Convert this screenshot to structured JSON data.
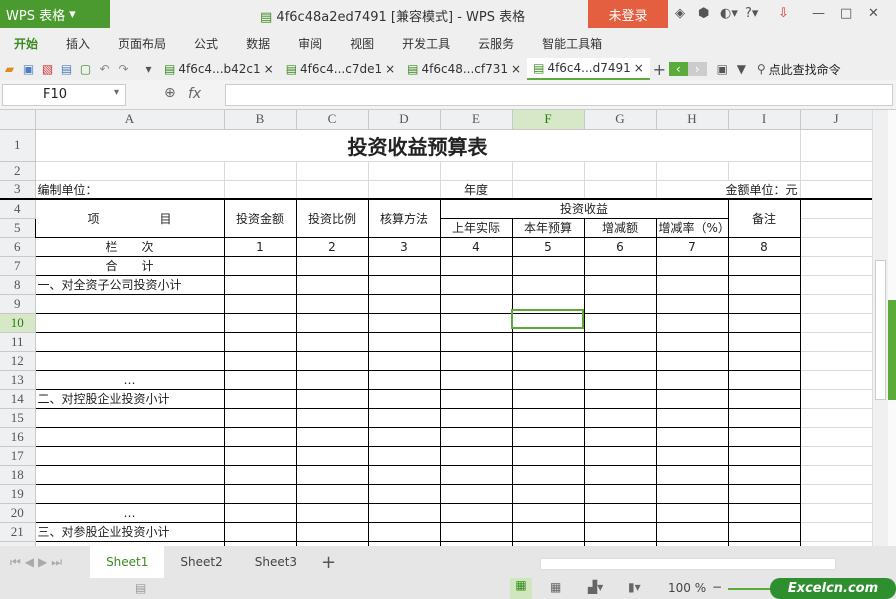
{
  "app": {
    "logo": "WPS 表格",
    "title": "4f6c48a2ed7491 [兼容模式] - WPS 表格",
    "login": "未登录"
  },
  "menu": [
    "开始",
    "插入",
    "页面布局",
    "公式",
    "数据",
    "审阅",
    "视图",
    "开发工具",
    "云服务",
    "智能工具箱"
  ],
  "doc_tabs": [
    {
      "label": "4f6c4...b42c1",
      "active": false
    },
    {
      "label": "4f6c4...c7de1",
      "active": false
    },
    {
      "label": "4f6c48...cf731",
      "active": false
    },
    {
      "label": "4f6c4...d7491",
      "active": true
    }
  ],
  "search_label": "点此查找命令",
  "formula": {
    "namebox": "F10",
    "fx": "fx",
    "value": ""
  },
  "columns": [
    "A",
    "B",
    "C",
    "D",
    "E",
    "F",
    "G",
    "H",
    "I",
    "J"
  ],
  "selected": {
    "col": "F",
    "row": "10"
  },
  "sheet": {
    "title": "投资收益预算表",
    "unit_label": "编制单位：",
    "year_label": "年度",
    "amount_unit": "金额单位：元",
    "header": {
      "item": "项　　　　　目",
      "amount": "投资金额",
      "ratio": "投资比例",
      "method": "核算方法",
      "income": "投资收益",
      "remark": "备注",
      "sub": [
        "上年实际",
        "本年预算",
        "增减额",
        "增减率（%）"
      ]
    },
    "index_row": {
      "label": "栏　　次",
      "nums": [
        "1",
        "2",
        "3",
        "4",
        "5",
        "6",
        "7",
        "8"
      ]
    },
    "total": "合　　计",
    "items": {
      "8": "一、对全资子公司投资小计",
      "13": "…",
      "14": "二、对控股企业投资小计",
      "20": "…",
      "21": "三、对参股企业投资小计"
    }
  },
  "sheet_tabs": [
    "Sheet1",
    "Sheet2",
    "Sheet3"
  ],
  "active_sheet": "Sheet1",
  "zoom": "100 %",
  "watermark": "Excelcn.com"
}
